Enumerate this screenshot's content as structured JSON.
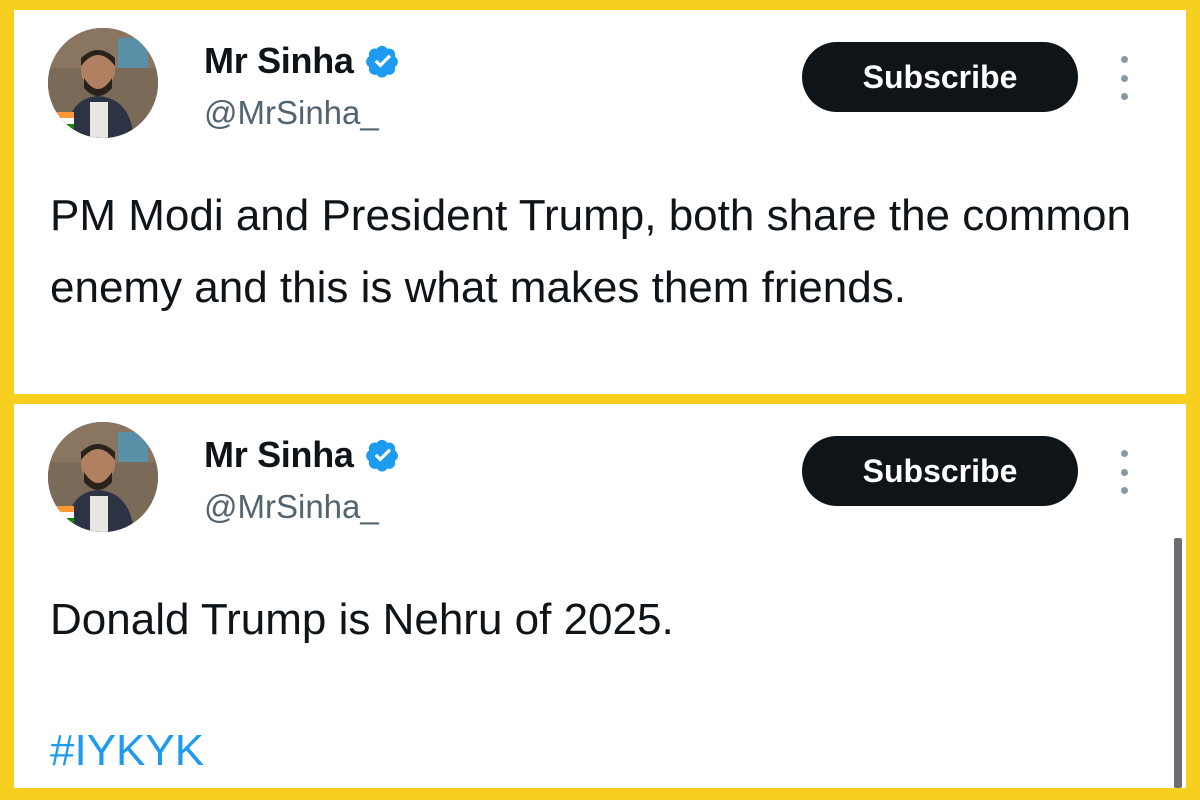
{
  "tweets": [
    {
      "author": {
        "name": "Mr Sinha",
        "handle": "@MrSinha_",
        "verified": true,
        "avatar_icon": "user-avatar-photo"
      },
      "subscribe_label": "Subscribe",
      "more_icon": "more-vertical-icon",
      "text": "PM Modi and President Trump, both share the common enemy and this is what makes them friends.",
      "hashtag": ""
    },
    {
      "author": {
        "name": "Mr Sinha",
        "handle": "@MrSinha_",
        "verified": true,
        "avatar_icon": "user-avatar-photo"
      },
      "subscribe_label": "Subscribe",
      "more_icon": "more-vertical-icon",
      "text": "Donald Trump is Nehru of 2025.",
      "hashtag": "#IYKYK"
    }
  ],
  "colors": {
    "background": "#f7cf1f",
    "card": "#ffffff",
    "text": "#0f1419",
    "handle": "#536471",
    "button": "#0f1419",
    "verified": "#1d9bf0",
    "link": "#1d9bf0"
  }
}
